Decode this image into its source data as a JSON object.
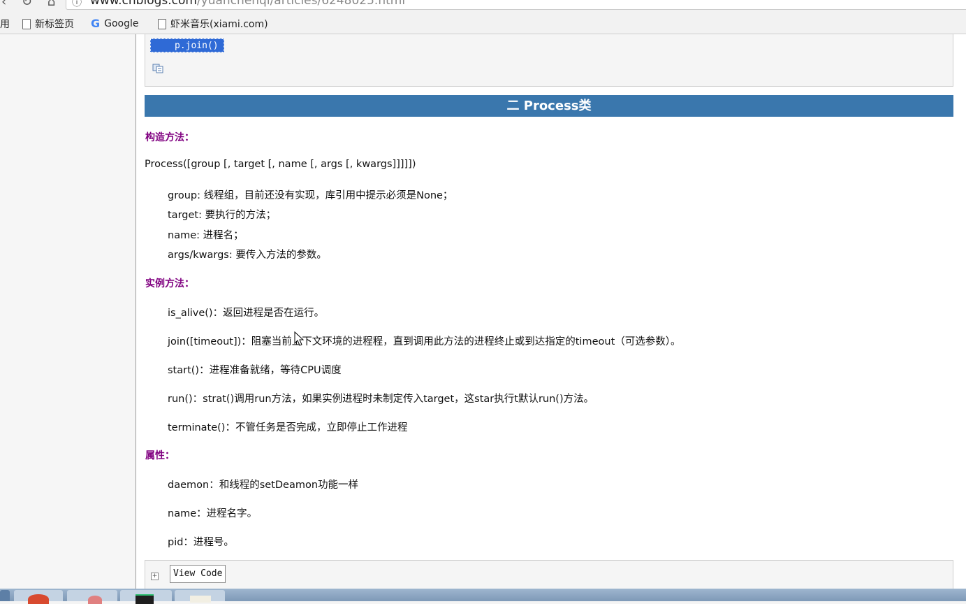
{
  "browser": {
    "url_host": "www.cnblogs.com",
    "url_path": "/yuanchenqi/articles/6248025.html",
    "nav_glyphs": "‹ ↻ ⌂",
    "bookmarks": {
      "apps_label": "用",
      "items": [
        {
          "label": "新标签页",
          "icon": "doc-icon"
        },
        {
          "label": "Google",
          "icon": "google-icon"
        },
        {
          "label": "虾米音乐(xiami.com)",
          "icon": "doc-icon"
        }
      ]
    }
  },
  "article": {
    "code_line": "p.join()",
    "section_title": "二 Process类",
    "constructor_label": "构造方法：",
    "constructor_signature": "Process([group [, target [, name [, args [, kwargs]]]]])",
    "constructor_params": [
      "group: 线程组，目前还没有实现，库引用中提示必须是None；",
      "target: 要执行的方法；",
      "name: 进程名；",
      "args/kwargs: 要传入方法的参数。"
    ],
    "instance_label": "实例方法：",
    "instance_methods": [
      "is_alive()：返回进程是否在运行。",
      "join([timeout])：阻塞当前上下文环境的进程程，直到调用此方法的进程终止或到达指定的timeout（可选参数）。",
      "start()：进程准备就绪，等待CPU调度",
      "run()：strat()调用run方法，如果实例进程时未制定传入target，这star执行t默认run()方法。",
      "terminate()：不管任务是否完成，立即停止工作进程"
    ],
    "attr_label": "属性：",
    "attributes": [
      "daemon：和线程的setDeamon功能一样",
      "name：进程名字。",
      "pid：进程号。"
    ],
    "view_code_label": "View Code",
    "expand_glyph": "+"
  },
  "colors": {
    "section_header_bg": "#3a77ad",
    "label_purple": "#800080",
    "selection_blue": "#2f6ad6"
  }
}
